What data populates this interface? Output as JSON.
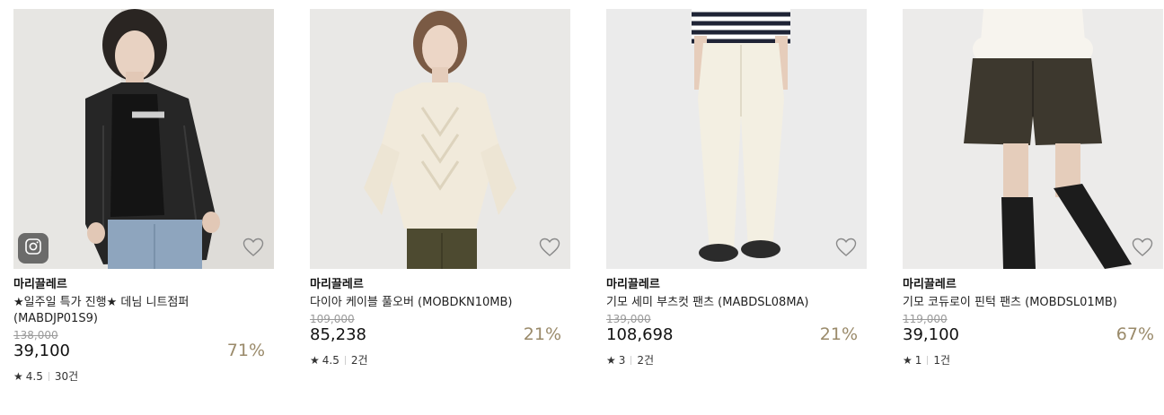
{
  "icons": {
    "badge": "instagram-icon",
    "wish": "heart-outline-icon",
    "rating": "star-icon"
  },
  "colors": {
    "discount": "#9a8a6a",
    "original_price": "#9a9a9a"
  },
  "products": [
    {
      "brand": "마리끌레르",
      "name": "★일주일 특가 진행★ 데님 니트점퍼 (MABDJP01S9)",
      "original_price": "138,000",
      "sale_price": "39,100",
      "discount": "71%",
      "rating": "4.5",
      "reviews": "30건",
      "has_instagram_badge": true
    },
    {
      "brand": "마리끌레르",
      "name": "다이아 케이블 풀오버 (MOBDKN10MB)",
      "original_price": "109,000",
      "sale_price": "85,238",
      "discount": "21%",
      "rating": "4.5",
      "reviews": "2건",
      "has_instagram_badge": false
    },
    {
      "brand": "마리끌레르",
      "name": "기모 세미 부츠컷 팬츠 (MABDSL08MA)",
      "original_price": "139,000",
      "sale_price": "108,698",
      "discount": "21%",
      "rating": "3",
      "reviews": "2건",
      "has_instagram_badge": false
    },
    {
      "brand": "마리끌레르",
      "name": "기모 코듀로이 핀턱 팬츠 (MOBDSL01MB)",
      "original_price": "119,000",
      "sale_price": "39,100",
      "discount": "67%",
      "rating": "1",
      "reviews": "1건",
      "has_instagram_badge": false
    }
  ]
}
